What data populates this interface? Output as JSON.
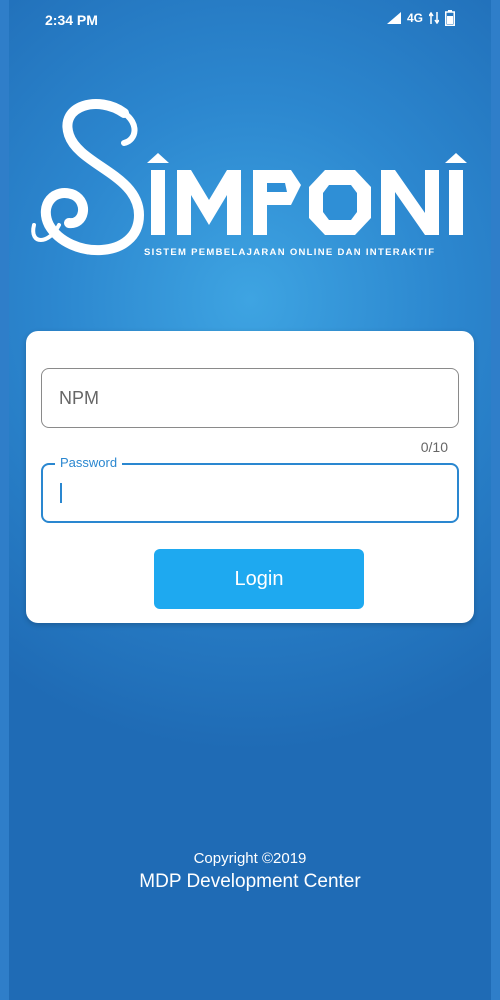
{
  "status_bar": {
    "time": "2:34 PM",
    "network": "4G",
    "icons": [
      "signal-icon",
      "data-arrows-icon",
      "battery-icon"
    ]
  },
  "logo": {
    "wordmark": "SIMPONI",
    "tagline": "SISTEM PEMBELAJARAN ONLINE DAN INTERAKTIF"
  },
  "login_form": {
    "npm": {
      "placeholder": "NPM",
      "value": "",
      "counter": "0/10"
    },
    "password": {
      "label": "Password",
      "value": ""
    },
    "login_label": "Login"
  },
  "footer": {
    "copyright": "Copyright ©2019",
    "organization": "MDP Development Center"
  },
  "colors": {
    "background": "#2c87cf",
    "accent": "#2a87d0",
    "button": "#1ea9f0",
    "card": "#ffffff"
  }
}
